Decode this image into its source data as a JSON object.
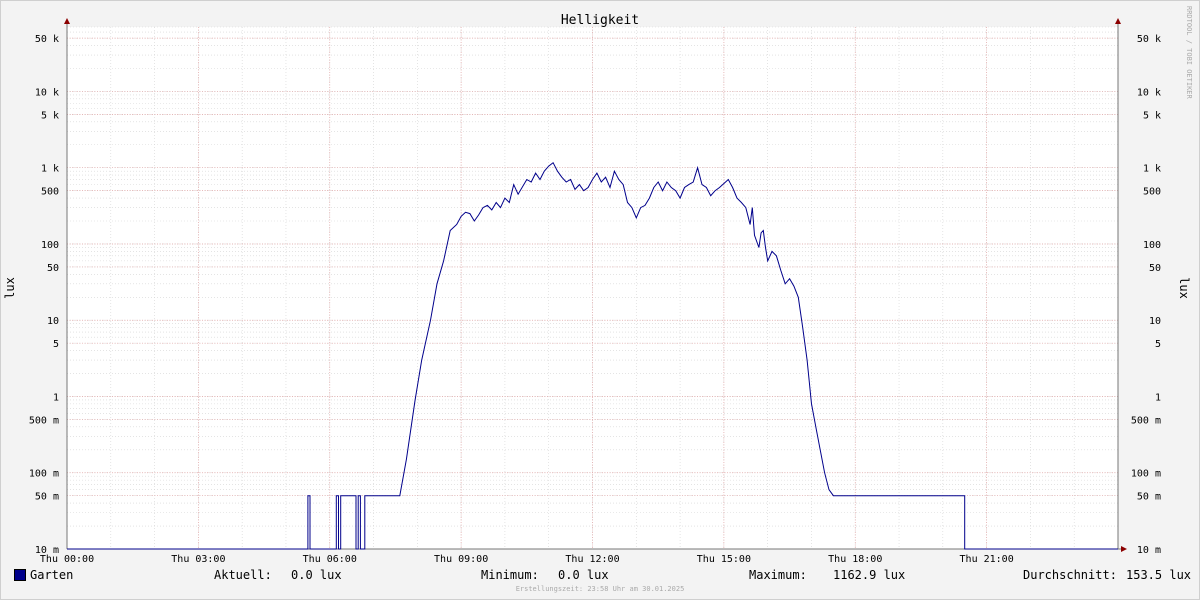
{
  "colors": {
    "series": "#00008b",
    "major_grid": "#e4a6a6",
    "minor_grid": "#d4d4d4",
    "axis": "#8b0000",
    "background": "#ffffff"
  },
  "chart_data": {
    "type": "line",
    "title": "Helligkeit",
    "ylabel_left": "lux",
    "ylabel_right": "lux",
    "yscale": "log",
    "ylim": [
      0.01,
      70000
    ],
    "xlim": [
      0,
      24
    ],
    "x_unit": "hours of day (Thu)",
    "x_ticks": [
      {
        "x": 0,
        "label": "Thu 00:00"
      },
      {
        "x": 3,
        "label": "Thu 03:00"
      },
      {
        "x": 6,
        "label": "Thu 06:00"
      },
      {
        "x": 9,
        "label": "Thu 09:00"
      },
      {
        "x": 12,
        "label": "Thu 12:00"
      },
      {
        "x": 15,
        "label": "Thu 15:00"
      },
      {
        "x": 18,
        "label": "Thu 18:00"
      },
      {
        "x": 21,
        "label": "Thu 21:00"
      }
    ],
    "y_ticks": [
      {
        "v": 50000,
        "label": "50 k"
      },
      {
        "v": 10000,
        "label": "10 k"
      },
      {
        "v": 5000,
        "label": "5 k"
      },
      {
        "v": 1000,
        "label": "1 k"
      },
      {
        "v": 500,
        "label": "500"
      },
      {
        "v": 100,
        "label": "100"
      },
      {
        "v": 50,
        "label": "50"
      },
      {
        "v": 10,
        "label": "10"
      },
      {
        "v": 5,
        "label": "5"
      },
      {
        "v": 1,
        "label": "1"
      },
      {
        "v": 0.5,
        "label": "500 m"
      },
      {
        "v": 0.1,
        "label": "100 m"
      },
      {
        "v": 0.05,
        "label": "50 m"
      },
      {
        "v": 0.01,
        "label": "10 m"
      }
    ],
    "series": [
      {
        "name": "Garten",
        "color": "#00008b",
        "points": [
          [
            0.0,
            0.01
          ],
          [
            5.5,
            0.01
          ],
          [
            5.5,
            0.05
          ],
          [
            5.55,
            0.05
          ],
          [
            5.55,
            0.01
          ],
          [
            6.15,
            0.01
          ],
          [
            6.15,
            0.05
          ],
          [
            6.2,
            0.05
          ],
          [
            6.2,
            0.01
          ],
          [
            6.25,
            0.01
          ],
          [
            6.25,
            0.05
          ],
          [
            6.6,
            0.05
          ],
          [
            6.6,
            0.01
          ],
          [
            6.65,
            0.01
          ],
          [
            6.65,
            0.05
          ],
          [
            6.7,
            0.05
          ],
          [
            6.7,
            0.01
          ],
          [
            6.8,
            0.01
          ],
          [
            6.8,
            0.05
          ],
          [
            7.6,
            0.05
          ],
          [
            7.75,
            0.15
          ],
          [
            7.95,
            0.9
          ],
          [
            8.1,
            3
          ],
          [
            8.3,
            10
          ],
          [
            8.45,
            30
          ],
          [
            8.6,
            60
          ],
          [
            8.75,
            150
          ],
          [
            8.9,
            180
          ],
          [
            9.0,
            230
          ],
          [
            9.1,
            260
          ],
          [
            9.2,
            250
          ],
          [
            9.3,
            200
          ],
          [
            9.4,
            240
          ],
          [
            9.5,
            300
          ],
          [
            9.6,
            320
          ],
          [
            9.7,
            280
          ],
          [
            9.8,
            350
          ],
          [
            9.9,
            300
          ],
          [
            10.0,
            400
          ],
          [
            10.1,
            350
          ],
          [
            10.2,
            600
          ],
          [
            10.3,
            450
          ],
          [
            10.5,
            700
          ],
          [
            10.6,
            650
          ],
          [
            10.7,
            850
          ],
          [
            10.8,
            700
          ],
          [
            10.9,
            900
          ],
          [
            11.0,
            1050
          ],
          [
            11.1,
            1162.9
          ],
          [
            11.2,
            900
          ],
          [
            11.3,
            750
          ],
          [
            11.4,
            650
          ],
          [
            11.5,
            700
          ],
          [
            11.6,
            520
          ],
          [
            11.7,
            600
          ],
          [
            11.8,
            500
          ],
          [
            11.9,
            550
          ],
          [
            12.0,
            700
          ],
          [
            12.1,
            850
          ],
          [
            12.2,
            650
          ],
          [
            12.3,
            750
          ],
          [
            12.4,
            550
          ],
          [
            12.5,
            900
          ],
          [
            12.6,
            700
          ],
          [
            12.7,
            600
          ],
          [
            12.8,
            350
          ],
          [
            12.9,
            300
          ],
          [
            13.0,
            220
          ],
          [
            13.1,
            300
          ],
          [
            13.2,
            320
          ],
          [
            13.3,
            400
          ],
          [
            13.4,
            550
          ],
          [
            13.5,
            650
          ],
          [
            13.6,
            500
          ],
          [
            13.7,
            650
          ],
          [
            13.8,
            550
          ],
          [
            13.9,
            500
          ],
          [
            14.0,
            400
          ],
          [
            14.1,
            550
          ],
          [
            14.2,
            600
          ],
          [
            14.3,
            650
          ],
          [
            14.4,
            1000
          ],
          [
            14.5,
            600
          ],
          [
            14.6,
            550
          ],
          [
            14.7,
            430
          ],
          [
            14.8,
            500
          ],
          [
            14.9,
            550
          ],
          [
            15.0,
            620
          ],
          [
            15.1,
            700
          ],
          [
            15.2,
            550
          ],
          [
            15.3,
            400
          ],
          [
            15.4,
            350
          ],
          [
            15.5,
            300
          ],
          [
            15.6,
            180
          ],
          [
            15.65,
            300
          ],
          [
            15.7,
            130
          ],
          [
            15.8,
            90
          ],
          [
            15.85,
            140
          ],
          [
            15.9,
            150
          ],
          [
            15.95,
            90
          ],
          [
            16.0,
            60
          ],
          [
            16.1,
            80
          ],
          [
            16.2,
            70
          ],
          [
            16.3,
            45
          ],
          [
            16.4,
            30
          ],
          [
            16.5,
            35
          ],
          [
            16.6,
            28
          ],
          [
            16.7,
            20
          ],
          [
            16.8,
            8
          ],
          [
            16.9,
            3
          ],
          [
            17.0,
            0.8
          ],
          [
            17.1,
            0.4
          ],
          [
            17.2,
            0.2
          ],
          [
            17.3,
            0.1
          ],
          [
            17.4,
            0.06
          ],
          [
            17.5,
            0.05
          ],
          [
            20.5,
            0.05
          ],
          [
            20.5,
            0.01
          ],
          [
            24.0,
            0.01
          ]
        ]
      }
    ]
  },
  "legend": {
    "series_name": "Garten",
    "current_label": "Aktuell:",
    "current_value": "0.0 lux",
    "min_label": "Minimum:",
    "min_value": "0.0 lux",
    "max_label": "Maximum:",
    "max_value": "1162.9 lux",
    "avg_label": "Durchschnitt:",
    "avg_value": "153.5 lux"
  },
  "footer": "Erstellungszeit: 23:58 Uhr am 30.01.2025",
  "watermark": "RRDTOOL / TOBI OETIKER"
}
